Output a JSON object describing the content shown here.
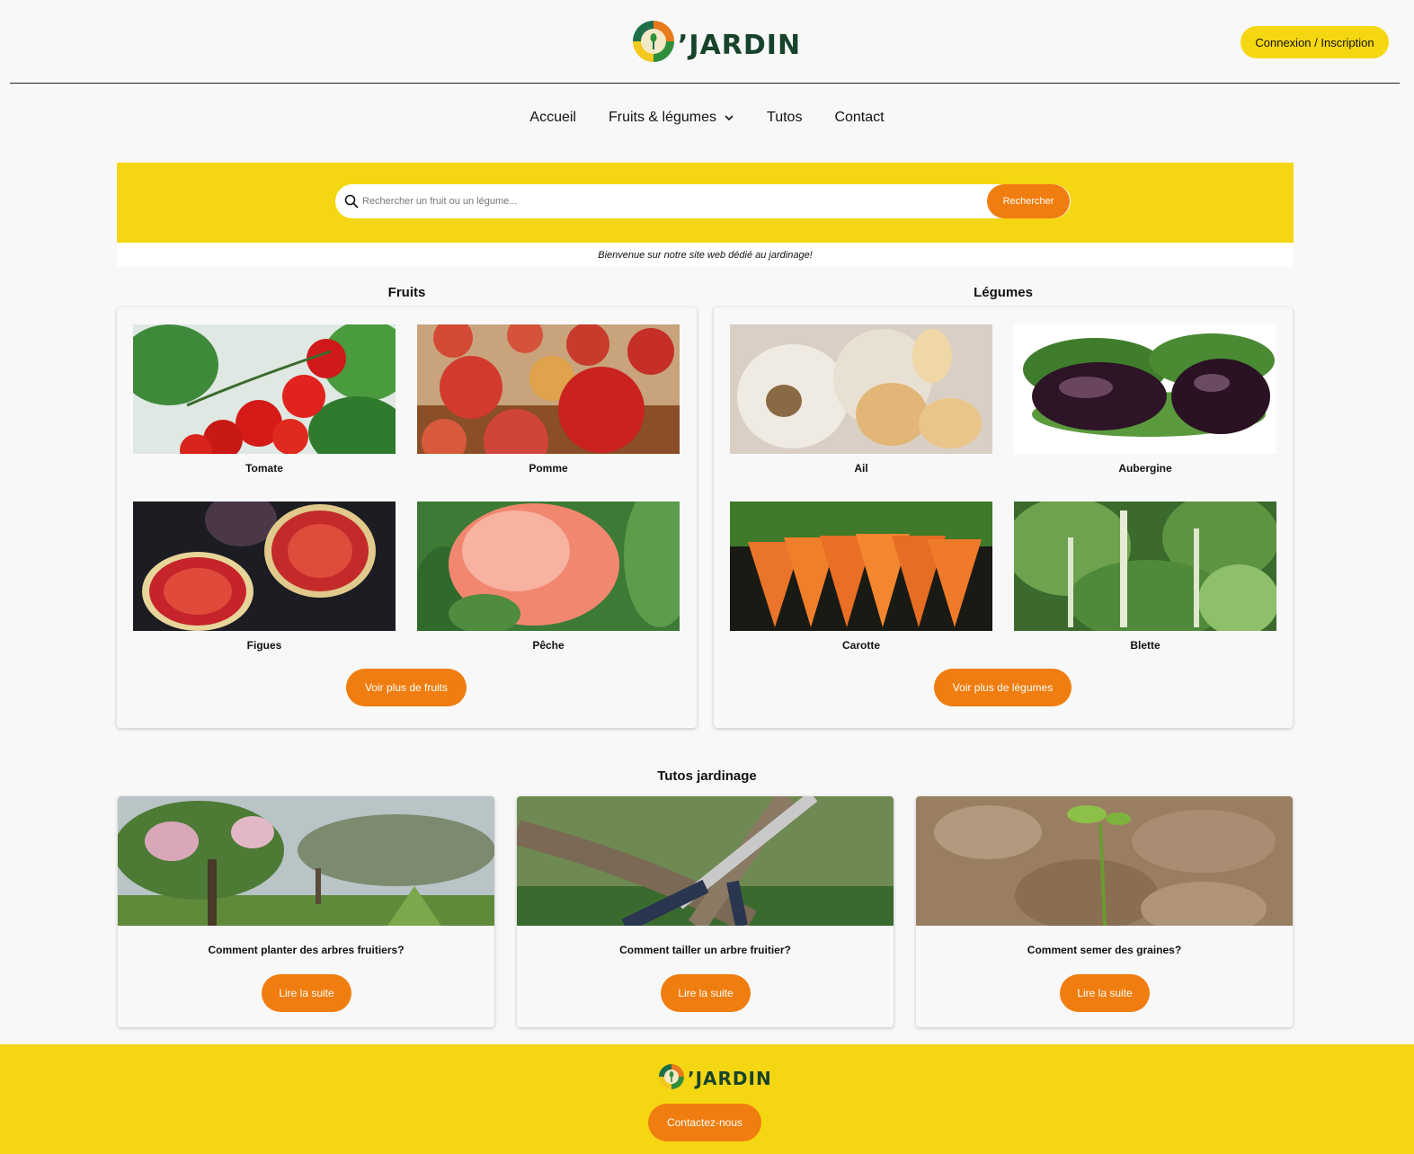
{
  "brand": {
    "logo_text": "’JARDIN",
    "accent": "#f5d612",
    "orange": "#f07d0f"
  },
  "header": {
    "login_label": "Connexion / Inscription"
  },
  "nav": {
    "items": [
      "Accueil",
      "Fruits & légumes",
      "Tutos",
      "Contact"
    ]
  },
  "search": {
    "placeholder": "Rechercher un fruit ou un légume...",
    "button": "Rechercher"
  },
  "welcome": "Bienvenue sur notre site web dédié au jardinage!",
  "fruits": {
    "title": "Fruits",
    "items": [
      "Tomate",
      "Pomme",
      "Figues",
      "Pêche"
    ],
    "more_button": "Voir plus de fruits"
  },
  "legumes": {
    "title": "Légumes",
    "items": [
      "Ail",
      "Aubergine",
      "Carotte",
      "Blette"
    ],
    "more_button": "Voir plus de légumes"
  },
  "tutos": {
    "title": "Tutos jardinage",
    "items": [
      {
        "title": "Comment planter des arbres fruitiers?",
        "button": "Lire la suite"
      },
      {
        "title": "Comment tailler un arbre fruitier?",
        "button": "Lire la suite"
      },
      {
        "title": "Comment semer des graines?",
        "button": "Lire la suite"
      }
    ]
  },
  "footer": {
    "contact_button": "Contactez-nous"
  }
}
